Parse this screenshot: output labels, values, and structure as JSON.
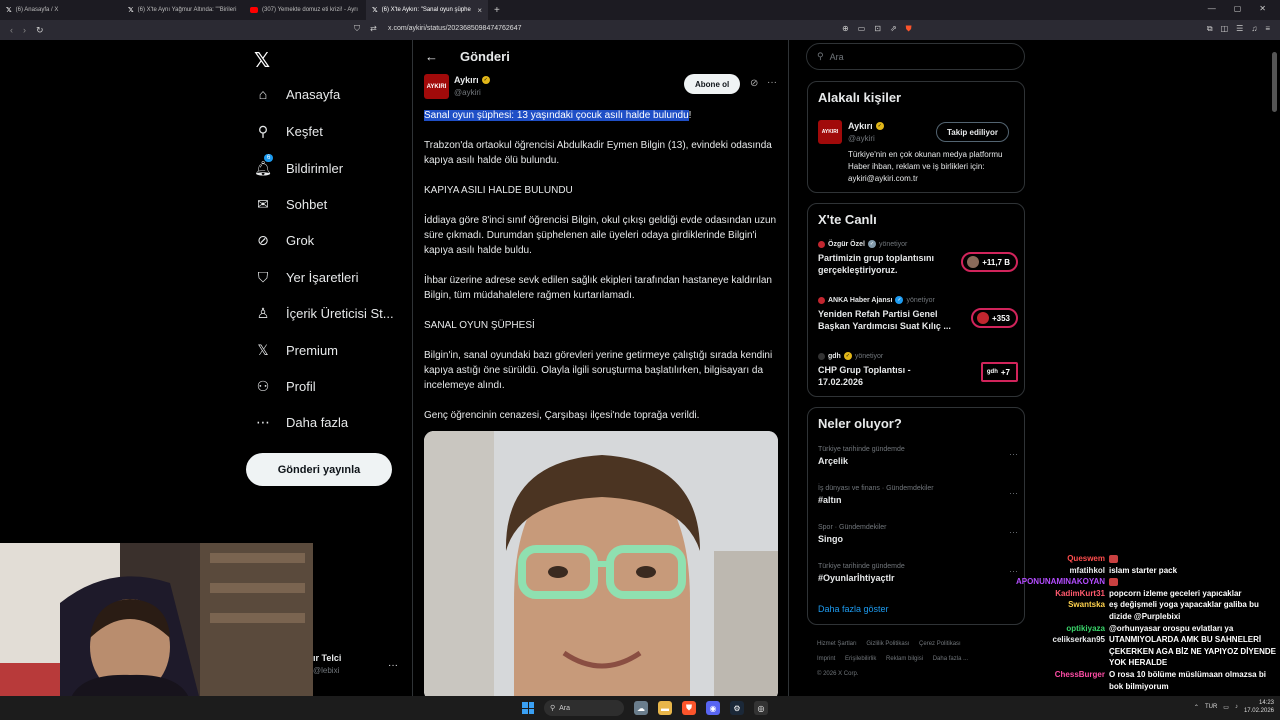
{
  "browser": {
    "tabs": [
      {
        "label": "(6) Anasayfa / X",
        "active": false
      },
      {
        "label": "(6) X'te Aynı Yağmur Altında: \"\"Birileri",
        "active": false
      },
      {
        "label": "(307) Yemekte domuz eti krizi! - Ayrı",
        "active": false
      },
      {
        "label": "(6) X'te Aykırı: \"Sanal oyun şüphe",
        "active": true
      }
    ],
    "new_tab": "+",
    "url": "x.com/aykiri/status/2023685098474762647",
    "window_controls": [
      "—",
      "▢",
      "✕"
    ]
  },
  "sidebar": {
    "logo": "𝕏",
    "items": [
      {
        "label": "Anasayfa",
        "icon": "home-icon",
        "glyph": "⌂"
      },
      {
        "label": "Keşfet",
        "icon": "search-icon",
        "glyph": "⚲"
      },
      {
        "label": "Bildirimler",
        "icon": "bell-icon",
        "glyph": "♫",
        "badge": "6"
      },
      {
        "label": "Sohbet",
        "icon": "mail-icon",
        "glyph": "✉"
      },
      {
        "label": "Grok",
        "icon": "grok-icon",
        "glyph": "⊘"
      },
      {
        "label": "Yer İşaretleri",
        "icon": "bookmark-icon",
        "glyph": "⛉"
      },
      {
        "label": "İçerik Üreticisi St...",
        "icon": "creator-icon",
        "glyph": "♙"
      },
      {
        "label": "Premium",
        "icon": "x-premium-icon",
        "glyph": "𝕏"
      },
      {
        "label": "Profil",
        "icon": "profile-icon",
        "glyph": "⚇"
      },
      {
        "label": "Daha fazla",
        "icon": "more-circle-icon",
        "glyph": "⋯"
      }
    ],
    "post_button": "Gönderi yayınla"
  },
  "main": {
    "header_title": "Gönderi",
    "author_name": "Aykırı",
    "author_handle": "@aykiri",
    "avatar_text": "AYKIRI",
    "subscribe_button": "Abone ol",
    "post": {
      "headline": "Sanal oyun şüphesi: 13 yaşındaki çocuk asılı halde bulundu",
      "headline_end": "!",
      "paragraphs": [
        "Trabzon'da ortaokul öğrencisi Abdulkadir Eymen Bilgin (13), evindeki odasında kapıya asılı halde ölü bulundu.",
        "KAPIYA ASILI HALDE BULUNDU",
        "İddiaya göre 8'inci sınıf öğrencisi Bilgin, okul çıkışı geldiği evde odasından uzun süre çıkmadı. Durumdan şüphelenen aile üyeleri odaya girdiklerinde Bilgin'i kapıya asılı halde buldu.",
        "İhbar üzerine adrese sevk edilen sağlık ekipleri tarafından hastaneye kaldırılan Bilgin, tüm müdahalelere rağmen kurtarılamadı.",
        "SANAL OYUN ŞÜPHESİ",
        "Bilgin'in, sanal oyundaki bazı görevleri yerine getirmeye çalıştığı sırada kendini kapıya astığı öne sürüldü. Olayla ilgili soruşturma başlatılırken, bilgisayarı da incelemeye alındı.",
        "Genç öğrencinin cenazesi, Çarşıbaşı ilçesi'nde toprağa verildi."
      ]
    }
  },
  "right": {
    "search_placeholder": "Ara",
    "related": {
      "title": "Alakalı kişiler",
      "name": "Aykırı",
      "handle": "@aykiri",
      "avatar_text": "AYKIRI",
      "bio": "Türkiye'nin en çok okunan medya platformu Haber ihban, reklam ve iş birlikleri için: aykiri@aykiri.com.tr",
      "follow_button": "Takip ediliyor"
    },
    "live": {
      "title": "X'te Canlı",
      "items": [
        {
          "host": "Özgür Özel",
          "role": "yönetiyor",
          "title": "Partimizin grup toplantısını gerçekleştiriyoruz.",
          "count": "+11,7 B"
        },
        {
          "host": "ANKA Haber Ajansı",
          "role": "yönetiyor",
          "title": "Yeniden Refah Partisi Genel Başkan Yardımcısı Suat Kılıç ...",
          "count": "+353"
        },
        {
          "host": "gdh",
          "role": "yönetiyor",
          "title": "CHP Grup Toplantısı - 17.02.2026",
          "count": "+7",
          "count_prefix": "gdh"
        }
      ]
    },
    "trends": {
      "title": "Neler oluyor?",
      "items": [
        {
          "meta": "Türkiye tarihinde gündemde",
          "name": "Arçelik"
        },
        {
          "meta": "İş dünyası ve finans · Gündemdekiler",
          "name": "#altın"
        },
        {
          "meta": "Spor · Gündemdekiler",
          "name": "Singo"
        },
        {
          "meta": "Türkiye tarihinde gündemde",
          "name": "#OyunlarİhtiyaçtIr"
        }
      ],
      "show_more": "Daha fazla göster"
    },
    "footer": [
      "Hizmet Şartları",
      "Gizlilik Politikası",
      "Çerez Politikası",
      "Imprint",
      "Erişilebilirlik",
      "Reklam bilgisi",
      "Daha fazla ...",
      "© 2026 X Corp."
    ]
  },
  "overlay_user": {
    "name": "ır Telci",
    "handle": "@lebixi"
  },
  "chat": [
    {
      "user": "Queswem",
      "color": "#ff4d4d",
      "msg": "",
      "emote": true
    },
    {
      "user": "mfatihkol",
      "color": "#e7e9ea",
      "msg": "islam starter pack"
    },
    {
      "user": "APONUNAMINAKOYAN",
      "color": "#b44dff",
      "msg": "",
      "emote": true
    },
    {
      "user": "KadimKurt31",
      "color": "#ff5a6e",
      "msg": "popcorn izleme geceleri yapıcaklar"
    },
    {
      "user": "Swantska",
      "color": "#ffd24d",
      "msg": "eş değişmeli yoga yapacaklar galiba bu dizide @Purplebixi"
    },
    {
      "user": "optikiyaza",
      "color": "#3ad46a",
      "msg": "@orhunyasar orospu evlatları ya"
    },
    {
      "user": "celikserkan95",
      "color": "#e7e9ea",
      "msg": "UTANMIYOLARDA AMK BU SAHNELERİ ÇEKERKEN AGA BİZ NE YAPIYOZ DİYENDE YOK HERALDE"
    },
    {
      "user": "ChessBurger",
      "color": "#ff4da6",
      "msg": "O rosa 10 bölüme müslümaan olmazsa bi bok bilmiyorum"
    }
  ],
  "taskbar": {
    "search": "Ara",
    "lang": "TUR",
    "time": "14:23",
    "date": "17.02.2026"
  }
}
